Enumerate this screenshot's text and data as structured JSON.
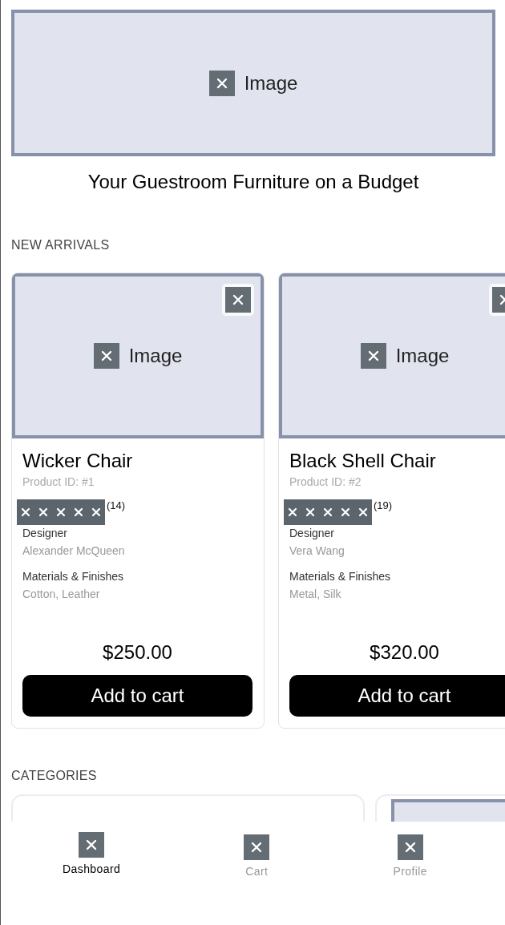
{
  "hero": {
    "image_alt": "Image",
    "title": "Your Guestroom Furniture on a Budget"
  },
  "new_arrivals": {
    "heading": "NEW ARRIVALS",
    "products": [
      {
        "image_alt": "Image",
        "name": "Wicker Chair",
        "product_id": "Product ID: #1",
        "review_count": "(14)",
        "designer_label": "Designer",
        "designer": "Alexander McQueen",
        "materials_label": "Materials & Finishes",
        "materials": "Cotton, Leather",
        "price": "$250.00",
        "button": "Add to cart"
      },
      {
        "image_alt": "Image",
        "name": "Black Shell Chair",
        "product_id": "Product ID: #2",
        "review_count": "(19)",
        "designer_label": "Designer",
        "designer": "Vera Wang",
        "materials_label": "Materials & Finishes",
        "materials": "Metal, Silk",
        "price": "$320.00",
        "button": "Add to cart"
      }
    ]
  },
  "categories": {
    "heading": "CATEGORIES",
    "items": [
      {
        "kind": "card"
      },
      {
        "kind": "image"
      }
    ]
  },
  "bottom_nav": [
    {
      "label": "Dashboard",
      "selected": true
    },
    {
      "label": "Cart",
      "selected": false
    },
    {
      "label": "Profile",
      "selected": false
    }
  ]
}
